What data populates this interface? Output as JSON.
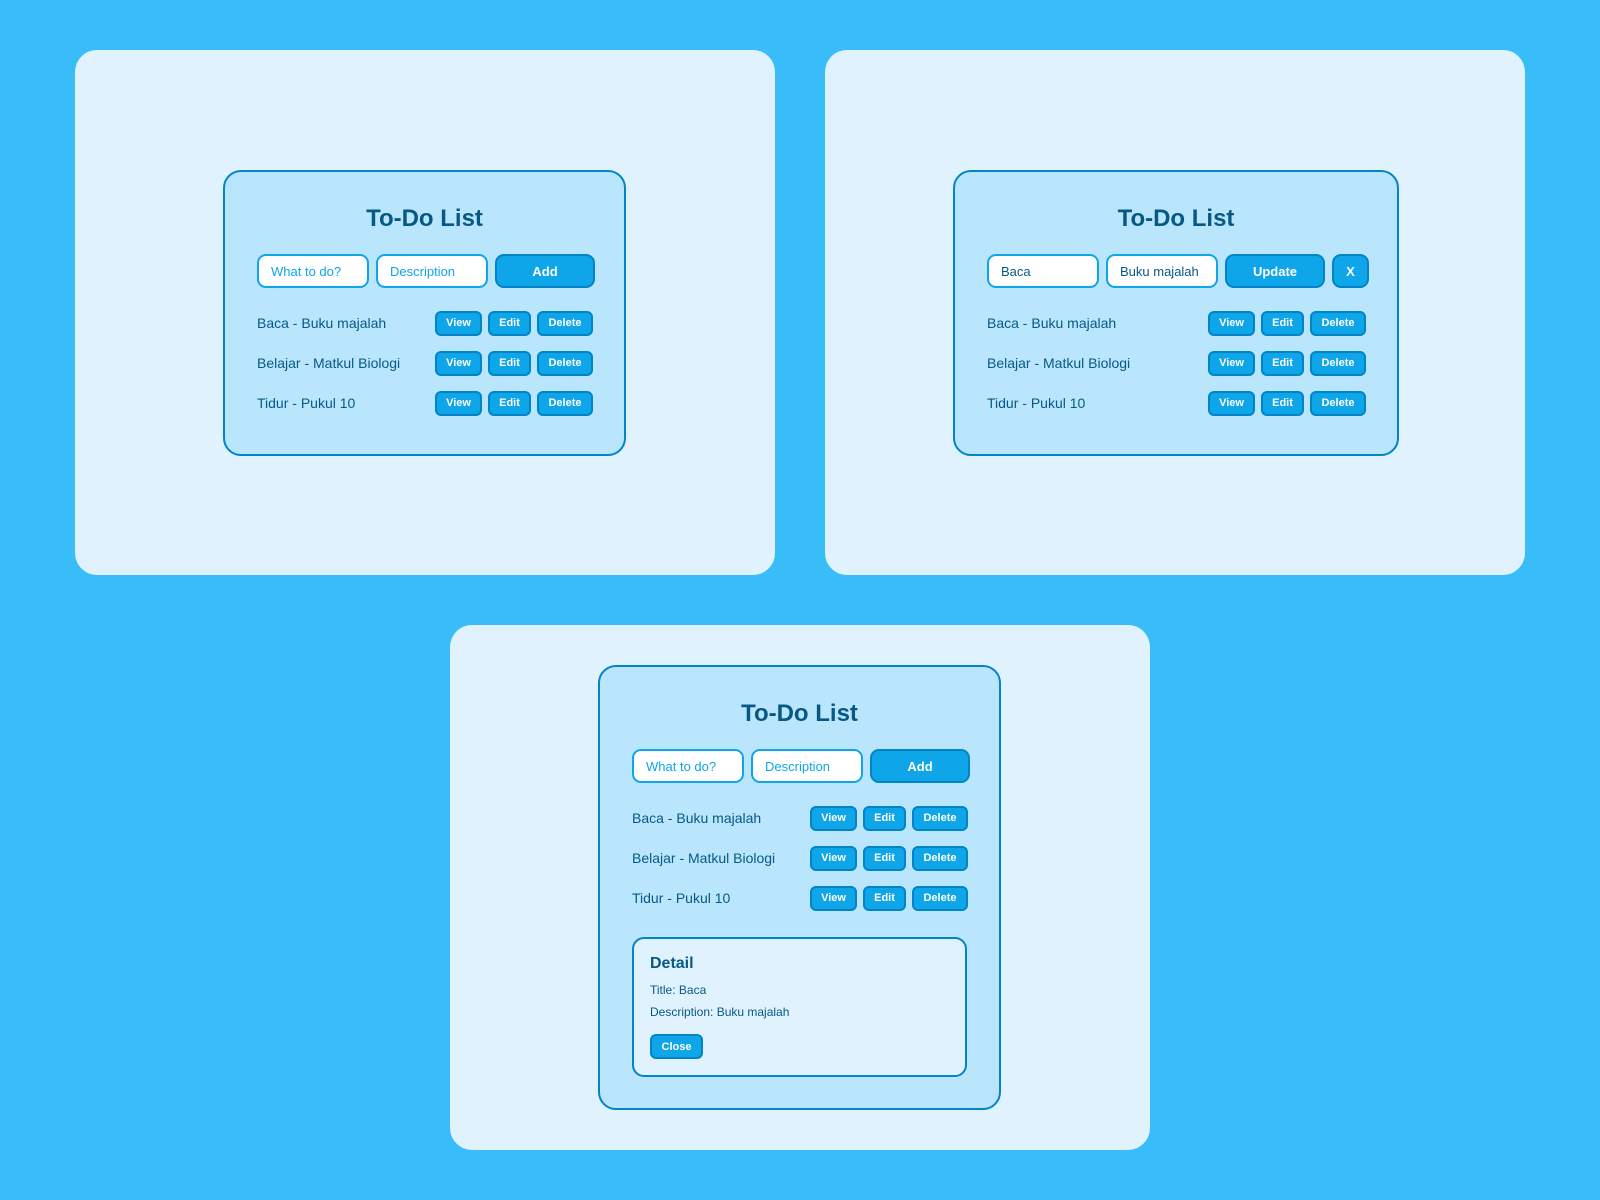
{
  "colors": {
    "background": "#38bdf8",
    "panel": "#e0f2fe",
    "card": "#bae6fd",
    "accent": "#0ea5e9",
    "border": "#0284c7",
    "text": "#075985"
  },
  "views": [
    {
      "title": "To-Do List",
      "inputs": {
        "task": {
          "value": "",
          "placeholder": "What to do?"
        },
        "description": {
          "value": "",
          "placeholder": "Description"
        }
      },
      "primary_button": "Add",
      "items": [
        {
          "text": "Baca - Buku majalah",
          "view": "View",
          "edit": "Edit",
          "delete": "Delete"
        },
        {
          "text": "Belajar - Matkul Biologi",
          "view": "View",
          "edit": "Edit",
          "delete": "Delete"
        },
        {
          "text": "Tidur - Pukul 10",
          "view": "View",
          "edit": "Edit",
          "delete": "Delete"
        }
      ]
    },
    {
      "title": "To-Do List",
      "inputs": {
        "task": {
          "value": "Baca",
          "placeholder": "What to do?"
        },
        "description": {
          "value": "Buku majalah",
          "placeholder": "Description"
        }
      },
      "primary_button": "Update",
      "cancel_button": "X",
      "items": [
        {
          "text": "Baca - Buku majalah",
          "view": "View",
          "edit": "Edit",
          "delete": "Delete"
        },
        {
          "text": "Belajar - Matkul Biologi",
          "view": "View",
          "edit": "Edit",
          "delete": "Delete"
        },
        {
          "text": "Tidur - Pukul 10",
          "view": "View",
          "edit": "Edit",
          "delete": "Delete"
        }
      ]
    },
    {
      "title": "To-Do List",
      "inputs": {
        "task": {
          "value": "",
          "placeholder": "What to do?"
        },
        "description": {
          "value": "",
          "placeholder": "Description"
        }
      },
      "primary_button": "Add",
      "items": [
        {
          "text": "Baca - Buku majalah",
          "view": "View",
          "edit": "Edit",
          "delete": "Delete"
        },
        {
          "text": "Belajar - Matkul Biologi",
          "view": "View",
          "edit": "Edit",
          "delete": "Delete"
        },
        {
          "text": "Tidur - Pukul 10",
          "view": "View",
          "edit": "Edit",
          "delete": "Delete"
        }
      ],
      "detail": {
        "heading": "Detail",
        "title_line": "Title: Baca",
        "description_line": "Description: Buku majalah",
        "close_button": "Close"
      }
    }
  ]
}
